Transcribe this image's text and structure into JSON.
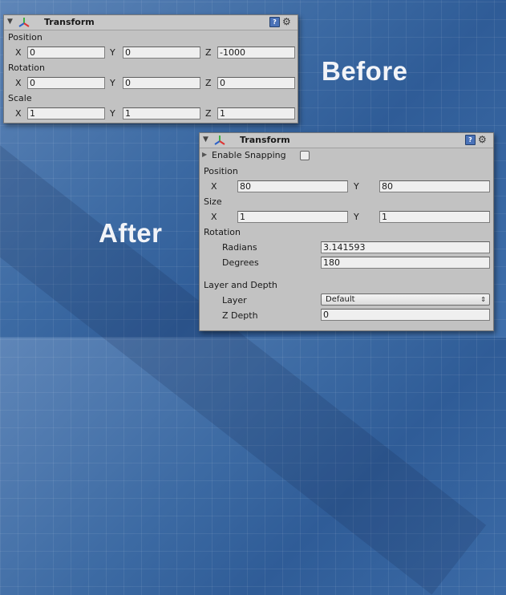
{
  "before_label": "Before",
  "after_label": "After",
  "top_panel": {
    "title": "Transform",
    "position": {
      "label": "Position",
      "x_label": "X",
      "x": "0",
      "y_label": "Y",
      "y": "0",
      "z_label": "Z",
      "z": "-1000"
    },
    "rotation": {
      "label": "Rotation",
      "x_label": "X",
      "x": "0",
      "y_label": "Y",
      "y": "0",
      "z_label": "Z",
      "z": "0"
    },
    "scale": {
      "label": "Scale",
      "x_label": "X",
      "x": "1",
      "y_label": "Y",
      "y": "1",
      "z_label": "Z",
      "z": "1"
    }
  },
  "bottom_panel": {
    "title": "Transform",
    "enable_snapping": "Enable Snapping",
    "position": {
      "label": "Position",
      "x_label": "X",
      "x": "80",
      "y_label": "Y",
      "y": "80"
    },
    "size": {
      "label": "Size",
      "x_label": "X",
      "x": "1",
      "y_label": "Y",
      "y": "1"
    },
    "rotation": {
      "label": "Rotation",
      "radians_label": "Radians",
      "radians": "3.141593",
      "degrees_label": "Degrees",
      "degrees": "180"
    },
    "layer_depth": {
      "label": "Layer and Depth",
      "layer_label": "Layer",
      "layer": "Default",
      "zdepth_label": "Z Depth",
      "zdepth": "0"
    }
  }
}
